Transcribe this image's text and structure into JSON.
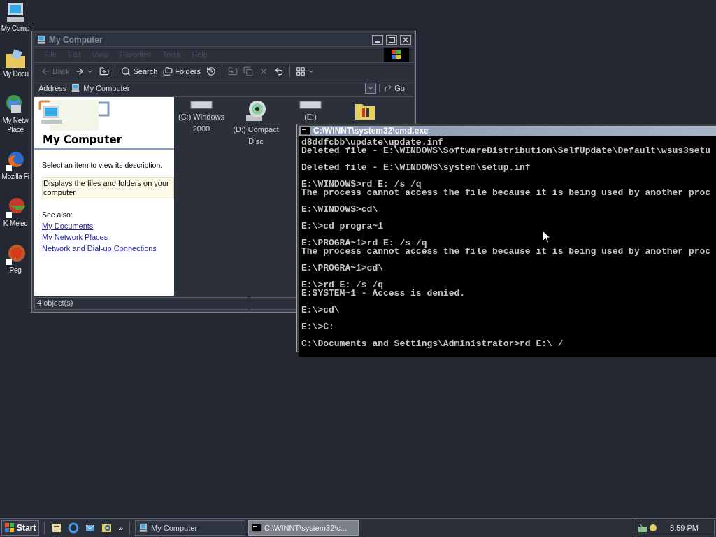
{
  "desktop_icons": [
    {
      "kind": "computer",
      "lines": [
        "My Comp"
      ]
    },
    {
      "kind": "documents",
      "lines": [
        "My Docu"
      ]
    },
    {
      "kind": "network",
      "lines": [
        "My Netw",
        "Place"
      ]
    },
    {
      "kind": "firefox",
      "lines": [
        "Mozilla Fi"
      ]
    },
    {
      "kind": "kmeleon",
      "lines": [
        "K-Melec"
      ]
    },
    {
      "kind": "pegasus",
      "lines": [
        "Peg"
      ]
    }
  ],
  "explorer": {
    "title": "My Computer",
    "active": false,
    "menu": [
      {
        "label": "File",
        "disabled": true
      },
      {
        "label": "Edit",
        "disabled": true
      },
      {
        "label": "View",
        "disabled": true
      },
      {
        "label": "Favorites",
        "disabled": true
      },
      {
        "label": "Tools",
        "disabled": true
      },
      {
        "label": "Help",
        "disabled": true
      }
    ],
    "toolbar": [
      {
        "kind": "back",
        "label": "Back",
        "disabled": true
      },
      {
        "kind": "forward",
        "disabled": false
      },
      {
        "kind": "up",
        "disabled": false
      },
      {
        "kind": "sep"
      },
      {
        "kind": "search",
        "label": "Search",
        "disabled": false
      },
      {
        "kind": "folders",
        "label": "Folders",
        "disabled": false
      },
      {
        "kind": "history",
        "disabled": false
      },
      {
        "kind": "sep"
      },
      {
        "kind": "moveto",
        "disabled": true
      },
      {
        "kind": "copyto",
        "disabled": true
      },
      {
        "kind": "delete",
        "disabled": true
      },
      {
        "kind": "undo",
        "disabled": false
      },
      {
        "kind": "sep"
      },
      {
        "kind": "views",
        "disabled": false
      }
    ],
    "address": {
      "label": "Address",
      "value": "My Computer",
      "go": "Go"
    },
    "side": {
      "heading": "My Computer",
      "hint": "Select an item to view its description.",
      "info": "Displays the files and folders on your computer",
      "see_also": "See also:",
      "links": [
        "My Documents",
        "My Network Places",
        "Network and Dial-up Connections"
      ]
    },
    "items": [
      {
        "kind": "drive",
        "lines": [
          "(C:) Windows",
          "2000"
        ]
      },
      {
        "kind": "cd",
        "lines": [
          "(D:) Compact",
          "Disc"
        ]
      },
      {
        "kind": "drive",
        "lines": [
          "(E:)"
        ]
      },
      {
        "kind": "control"
      }
    ],
    "status": "4 object(s)"
  },
  "console": {
    "title": "C:\\WINNT\\system32\\cmd.exe",
    "active": true,
    "blocks": [
      [
        "d8ddfcbb\\update\\update.inf",
        "Deleted file - E:\\WINDOWS\\SoftwareDistribution\\SelfUpdate\\Default\\wsus3setu"
      ],
      [
        "Deleted file - E:\\WINDOWS\\system\\setup.inf"
      ],
      [
        "E:\\WINDOWS>rd E: /s /q",
        "The process cannot access the file because it is being used by another proc"
      ],
      [
        "E:\\WINDOWS>cd\\"
      ],
      [
        "E:\\>cd progra~1"
      ],
      [
        "E:\\PROGRA~1>rd E: /s /q",
        "The process cannot access the file because it is being used by another proc"
      ],
      [
        "E:\\PROGRA~1>cd\\"
      ],
      [
        "E:\\>rd E: /s /q",
        "E:SYSTEM~1 - Access is denied."
      ],
      [
        "E:\\>cd\\"
      ],
      [
        "E:\\>C:"
      ],
      [
        "C:\\Documents and Settings\\Administrator>rd E:\\ /"
      ]
    ]
  },
  "taskbar": {
    "start": "Start",
    "quick": [
      {
        "kind": "desktop"
      },
      {
        "kind": "ie"
      },
      {
        "kind": "outlook"
      },
      {
        "kind": "search"
      }
    ],
    "more": "»",
    "tasks": [
      {
        "label": "My Computer",
        "kind": "explorer",
        "selected": false
      },
      {
        "label": "C:\\WINNT\\system32\\c...",
        "kind": "console",
        "selected": true
      }
    ],
    "clock": "8:59 PM"
  }
}
